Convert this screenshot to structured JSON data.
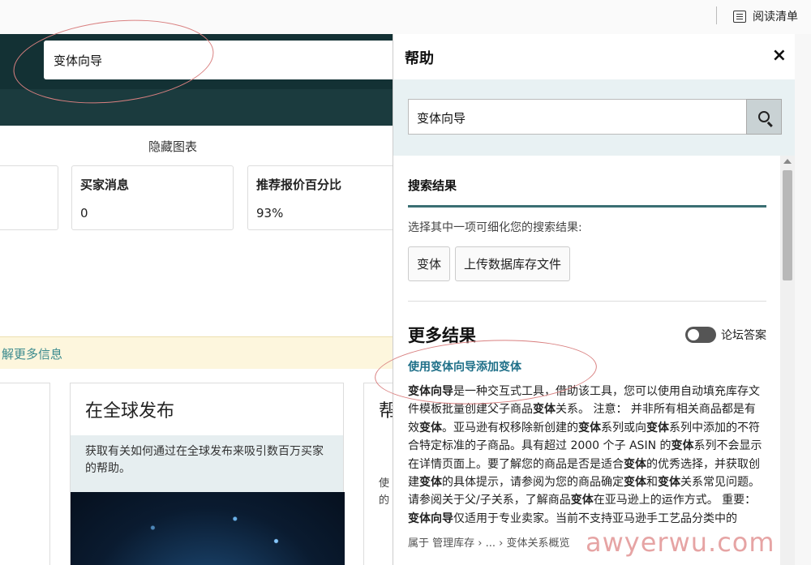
{
  "top_bar": {
    "reading_list_label": "阅读清单"
  },
  "left_page": {
    "search_value": "变体向导",
    "hide_chart_label": "隐藏图表",
    "metric_cards": [
      {
        "title": "",
        "value": ""
      },
      {
        "title": "买家消息",
        "value": "0"
      },
      {
        "title": "推荐报价百分比",
        "value": "93%"
      }
    ],
    "info_bar_text": "解更多信息",
    "feature_cards": [
      {
        "title": "在全球发布",
        "description": "获取有关如何通过在全球发布来吸引数百万买家的帮助。"
      },
      {
        "title": "帮",
        "text": "使\n的"
      }
    ]
  },
  "help_panel": {
    "title": "帮助",
    "close_label": "×",
    "search_value": "变体向导",
    "search_results_title": "搜索结果",
    "refine_hint": "选择其中一项可细化您的搜索结果:",
    "chips": [
      "变体",
      "上传数据库存文件"
    ],
    "more_results_title": "更多结果",
    "toggle_label": "论坛答案",
    "result": {
      "link": "使用变体向导添加变体",
      "snippet_html": "<b>变体向导</b>是一种交互式工具，借助该工具，您可以使用自动填充库存文件模板批量创建父子商品<b>变体</b>关系。 注意： 并非所有相关商品都是有效<b>变体</b>。亚马逊有权移除新创建的<b>变体</b>系列或向<b>变体</b>系列中添加的不符合特定标准的子商品。具有超过 2000 个子 ASIN 的<b>变体</b>系列不会显示在详情页面上。要了解您的商品是否是适合<b>变体</b>的优秀选择，并获取创建<b>变体</b>的具体提示，请参阅为您的商品确定<b>变体</b>和<b>变体</b>关系常见问题。请参阅关于父/子关系，了解商品<b>变体</b>在亚马逊上的运作方式。 重要： <b>变体向导</b>仅适用于专业卖家。当前不支持亚马逊手工艺品分类中的",
      "breadcrumb": "属于 管理库存 › ... › 变体关系概览"
    }
  },
  "watermark": "awyerwu.com",
  "colors": {
    "header_dark": "#1b3b3e",
    "link": "#1e6f88",
    "accent_line": "#3a6f73",
    "info_bar_bg": "#fdf6dd"
  }
}
